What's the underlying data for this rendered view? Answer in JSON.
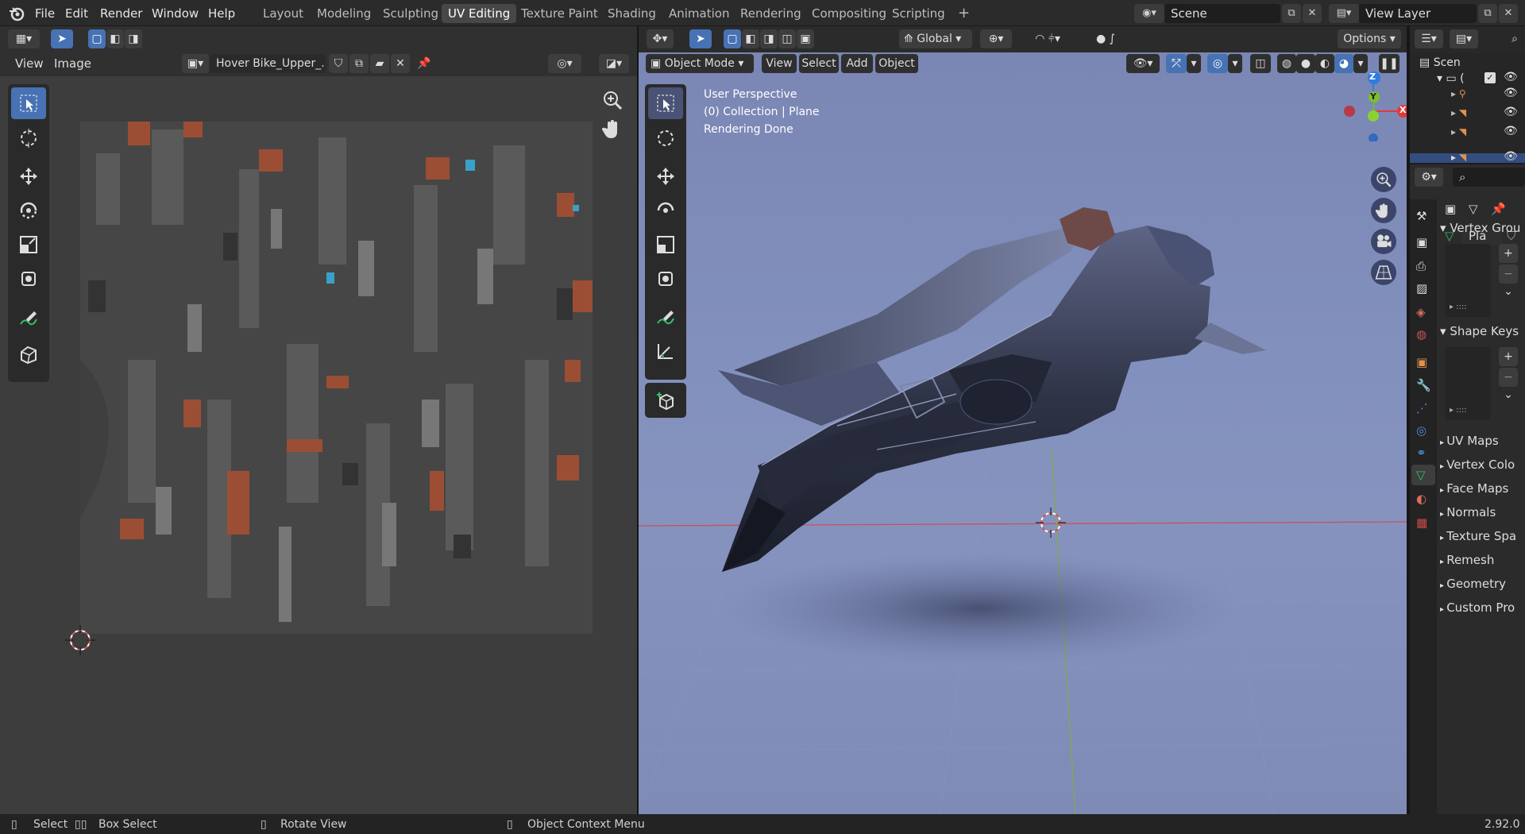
{
  "topbar": {
    "menus": [
      "File",
      "Edit",
      "Render",
      "Window",
      "Help"
    ],
    "workspaces": [
      "Layout",
      "Modeling",
      "Sculpting",
      "UV Editing",
      "Texture Paint",
      "Shading",
      "Animation",
      "Rendering",
      "Compositing",
      "Scripting"
    ],
    "active_workspace": "UV Editing",
    "add_tab": "+",
    "scene": "Scene",
    "view_layer": "View Layer"
  },
  "uv_editor": {
    "menus": [
      "View",
      "Image"
    ],
    "image_name": "Hover Bike_Upper_..."
  },
  "viewport": {
    "header": {
      "orientation": "Global",
      "options": "Options",
      "mode": "Object Mode",
      "menus": [
        "View",
        "Select",
        "Add",
        "Object"
      ]
    },
    "overlay_text": {
      "line1": "User Perspective",
      "line2": "(0) Collection | Plane",
      "line3": "Rendering Done"
    },
    "gizmo": {
      "z": "Z",
      "y": "Y",
      "x": "X"
    }
  },
  "outliner": {
    "scene_label": "Scen",
    "collection_label": "("
  },
  "properties": {
    "object_name": "Pla",
    "panels": {
      "vertex_groups": "Vertex Grou",
      "shape_keys": "Shape Keys",
      "uv_maps": "UV Maps",
      "vertex_colors": "Vertex Colo",
      "face_maps": "Face Maps",
      "normals": "Normals",
      "texture_space": "Texture Spa",
      "remesh": "Remesh",
      "geometry": "Geometry",
      "custom_props": "Custom Pro"
    },
    "list_dots": "::::",
    "plus": "+",
    "minus": "−"
  },
  "statusbar": {
    "select": "Select",
    "box_select": "Box Select",
    "rotate_view": "Rotate View",
    "context_menu": "Object Context Menu",
    "version": "2.92.0"
  },
  "colors": {
    "accent": "#4772b3",
    "active_tab": "#474747",
    "axis_x": "#e23a3a",
    "axis_y": "#7cc02a",
    "axis_z": "#2f7ce0"
  }
}
